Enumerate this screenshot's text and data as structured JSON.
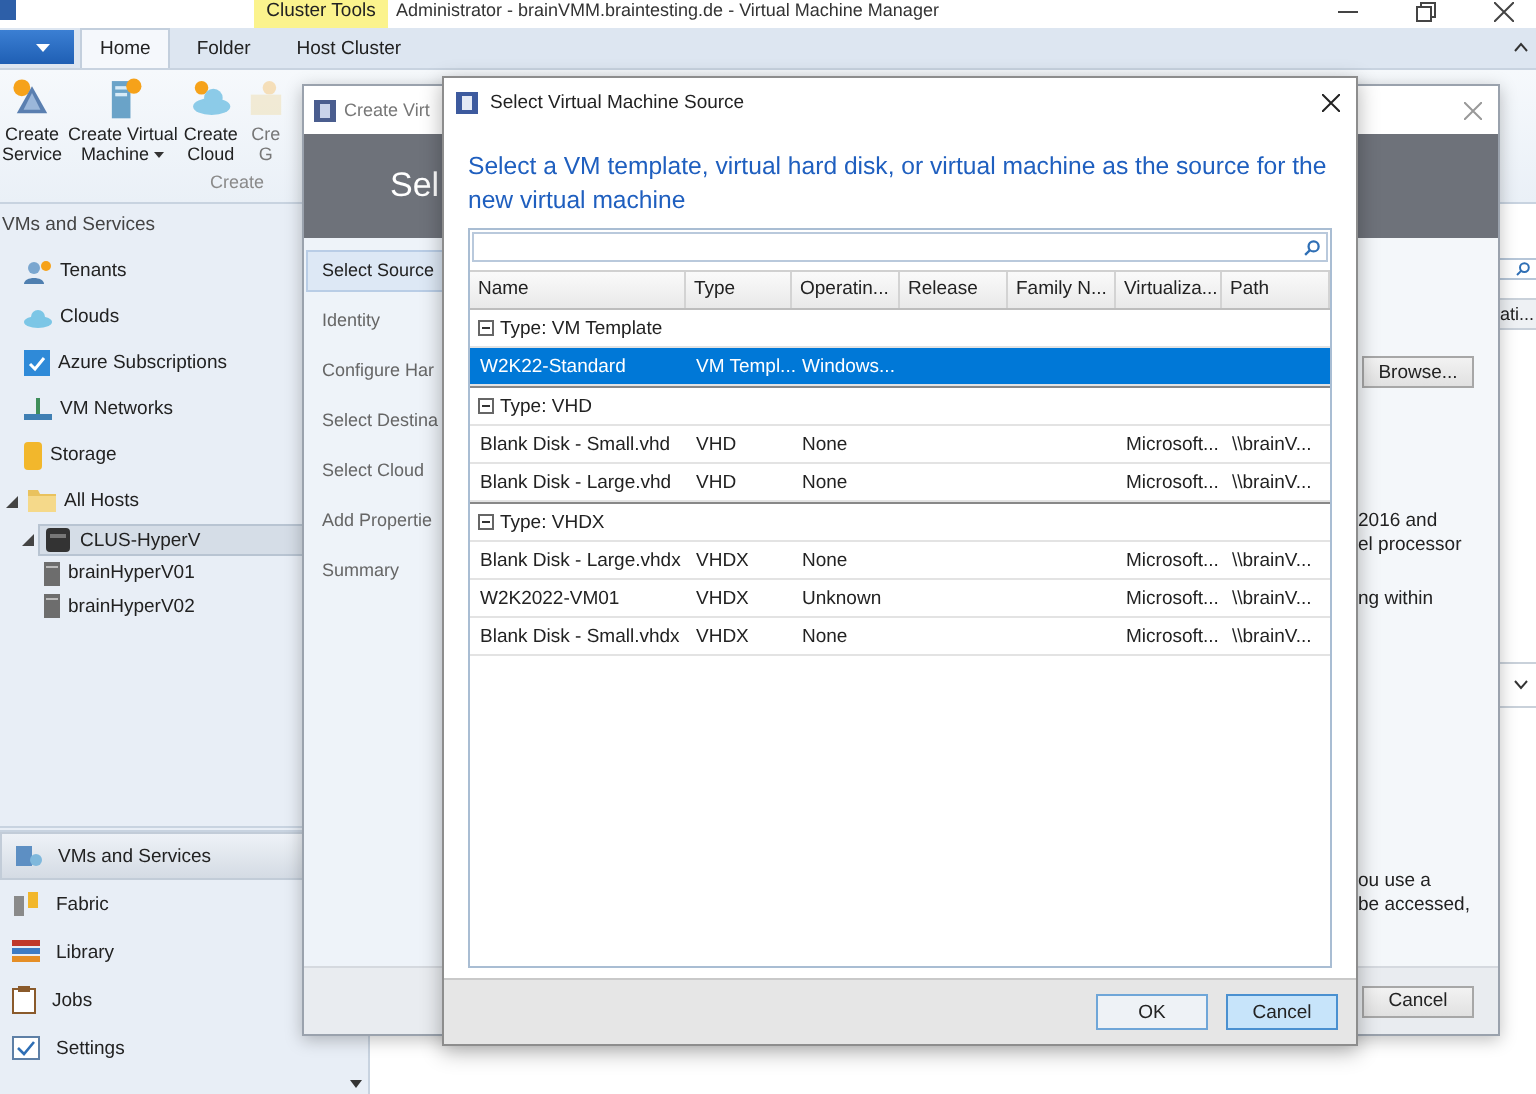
{
  "main_window": {
    "title": "Administrator - brainVMM.braintesting.de - Virtual Machine Manager",
    "context_tab": "Cluster Tools",
    "tabs": [
      {
        "label": "Home",
        "selected": true
      },
      {
        "label": "Folder",
        "selected": false
      },
      {
        "label": "Host Cluster",
        "selected": false
      }
    ],
    "ribbon_buttons": [
      {
        "lines": [
          "Create",
          "Service"
        ],
        "dropdown": false,
        "disabled": false
      },
      {
        "lines": [
          "Create Virtual",
          "Machine"
        ],
        "dropdown": true,
        "disabled": false
      },
      {
        "lines": [
          "Create",
          "Cloud"
        ],
        "dropdown": false,
        "disabled": false
      },
      {
        "lines": [
          "Cre",
          "G"
        ],
        "dropdown": false,
        "disabled": true
      }
    ],
    "ribbon_group": "Create",
    "nav_heading": "VMs and Services",
    "nav_tree": [
      {
        "label": "Tenants",
        "selected": false
      },
      {
        "label": "Clouds",
        "selected": false
      },
      {
        "label": "Azure Subscriptions",
        "selected": false
      },
      {
        "label": "VM Networks",
        "selected": false
      },
      {
        "label": "Storage",
        "selected": false
      },
      {
        "label": "All Hosts",
        "selected": false,
        "expanded": true,
        "children": [
          {
            "label": "CLUS-HyperV",
            "selected": true,
            "expanded": true,
            "children": [
              {
                "label": "brainHyperV01",
                "selected": false
              },
              {
                "label": "brainHyperV02",
                "selected": false
              }
            ]
          }
        ]
      }
    ],
    "workspaces": [
      {
        "label": "VMs and Services",
        "selected": true
      },
      {
        "label": "Fabric",
        "selected": false
      },
      {
        "label": "Library",
        "selected": false
      },
      {
        "label": "Jobs",
        "selected": false
      },
      {
        "label": "Settings",
        "selected": false
      }
    ],
    "grid_column": "ati..."
  },
  "wizard": {
    "title": "Create Virt",
    "header": "Sel",
    "steps": [
      {
        "label": "Select Source",
        "selected": true
      },
      {
        "label": "Identity",
        "selected": false
      },
      {
        "label": "Configure Har",
        "selected": false
      },
      {
        "label": "Select Destina",
        "selected": false
      },
      {
        "label": "Select Cloud",
        "selected": false
      },
      {
        "label": "Add Propertie",
        "selected": false
      },
      {
        "label": "Summary",
        "selected": false
      }
    ],
    "browse_button": "Browse...",
    "text_upper": [
      "2016 and",
      "el processor",
      "ng within"
    ],
    "text_lower": [
      "ou use a",
      "be accessed,"
    ],
    "cancel_button": "Cancel"
  },
  "dialog": {
    "title": "Select Virtual Machine Source",
    "instruction": "Select a VM template, virtual hard disk, or virtual machine as the source for the new virtual machine",
    "columns": [
      "Name",
      "Type",
      "Operatin...",
      "Release",
      "Family N...",
      "Virtualiza...",
      "Path"
    ],
    "groups": [
      {
        "label": "Type:  VM Template",
        "expanded": true,
        "rows": [
          {
            "name": "W2K22-Standard",
            "type": "VM Templ...",
            "operating_system": "Windows...",
            "selected": true
          }
        ]
      },
      {
        "label": "Type:  VHD",
        "expanded": true,
        "rows": [
          {
            "name": "Blank Disk - Small.vhd",
            "type": "VHD",
            "operating_system": "None",
            "virtualization_platform": "Microsoft...",
            "path": "\\\\brainV...",
            "selected": false
          },
          {
            "name": "Blank Disk - Large.vhd",
            "type": "VHD",
            "operating_system": "None",
            "virtualization_platform": "Microsoft...",
            "path": "\\\\brainV...",
            "selected": false
          }
        ]
      },
      {
        "label": "Type:  VHDX",
        "expanded": true,
        "rows": [
          {
            "name": "Blank Disk - Large.vhdx",
            "type": "VHDX",
            "operating_system": "None",
            "virtualization_platform": "Microsoft...",
            "path": "\\\\brainV...",
            "selected": false
          },
          {
            "name": "W2K2022-VM01",
            "type": "VHDX",
            "operating_system": "Unknown",
            "virtualization_platform": "Microsoft...",
            "path": "\\\\brainV...",
            "selected": false
          },
          {
            "name": "Blank Disk - Small.vhdx",
            "type": "VHDX",
            "operating_system": "None",
            "virtualization_platform": "Microsoft...",
            "path": "\\\\brainV...",
            "selected": false
          }
        ]
      }
    ],
    "buttons": [
      {
        "label": "OK",
        "highlighted": false
      },
      {
        "label": "Cancel",
        "highlighted": true
      }
    ]
  }
}
